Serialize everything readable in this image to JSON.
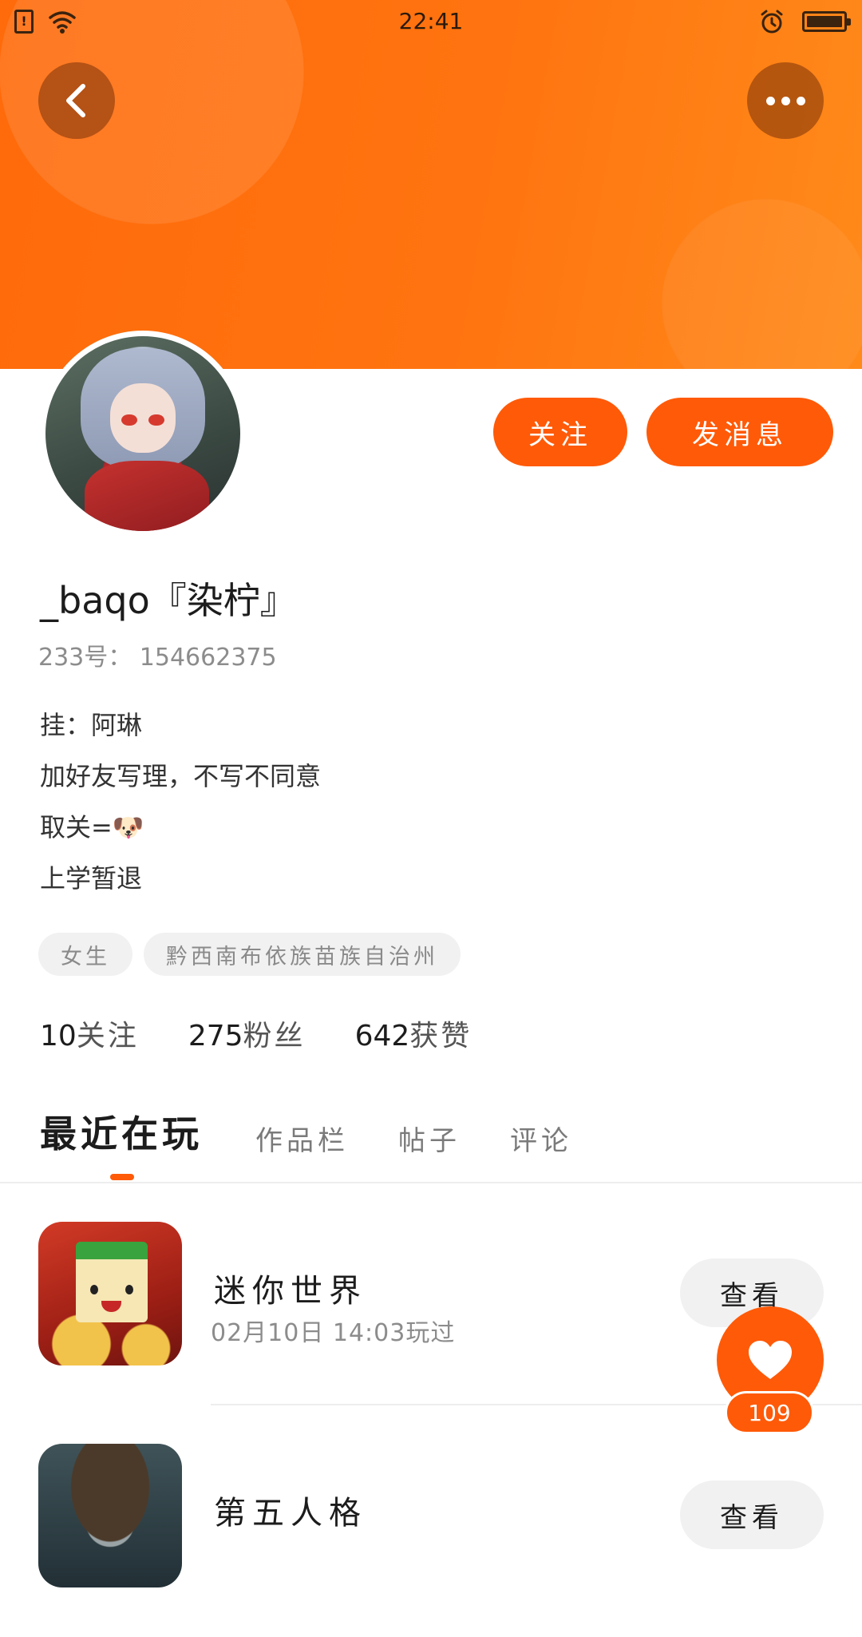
{
  "status_bar": {
    "time": "22:41",
    "icons": [
      "sim-alert-icon",
      "wifi-icon",
      "alarm-icon",
      "battery-icon"
    ]
  },
  "header": {
    "back_icon": "chevron-left-icon",
    "more_icon": "more-dots-icon",
    "banner_color": "#ff7410"
  },
  "profile": {
    "name": "_baqo『染柠』",
    "id_line": "233号： 154662375",
    "follow_label": "关注",
    "message_label": "发消息",
    "bio": [
      "挂：阿琳",
      "加好友写理，不写不同意",
      "取关=🐶",
      "上学暂退"
    ],
    "tags": [
      "女生",
      "黔西南布依族苗族自治州"
    ],
    "stats": [
      {
        "value": "10",
        "label": "关注"
      },
      {
        "value": "275",
        "label": "粉丝"
      },
      {
        "value": "642",
        "label": "获赞"
      }
    ]
  },
  "tabs": [
    {
      "label": "最近在玩",
      "active": true
    },
    {
      "label": "作品栏",
      "active": false
    },
    {
      "label": "帖子",
      "active": false
    },
    {
      "label": "评论",
      "active": false
    }
  ],
  "games": [
    {
      "title": "迷你世界",
      "time": "02月10日 14:03玩过",
      "button": "查看"
    },
    {
      "title": "第五人格",
      "time": "",
      "button": "查看"
    }
  ],
  "like": {
    "count": "109",
    "icon": "heart-icon"
  },
  "colors": {
    "accent": "#ff5a08"
  }
}
